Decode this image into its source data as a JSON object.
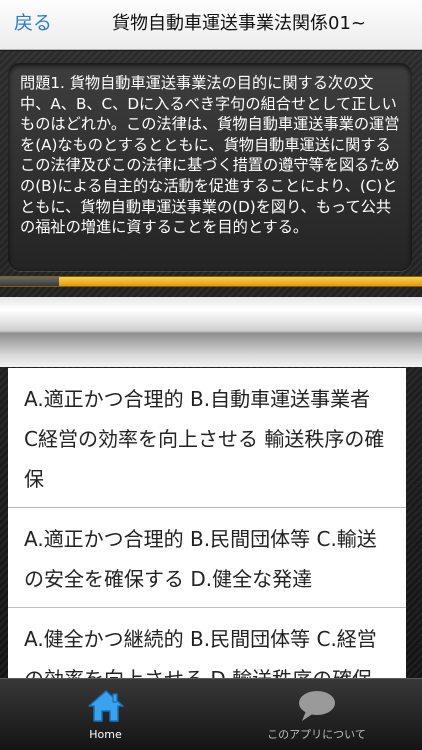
{
  "navbar": {
    "back_label": "戻る",
    "title": "貨物自動車運送事業法関係01~"
  },
  "question": {
    "text": "問題1. 貨物自動車運送事業法の目的に関する次の文中、A、B、C、Dに入るべき字句の組合せとして正しいものはどれか。この法律は、貨物自動車運送事業の運営を(A)なものとするとともに、貨物自動車運送に関するこの法律及びこの法律に基づく措置の遵守等を図るための(B)による自主的な活動を促進することにより、(C)とともに、貨物自動車運送事業の(D)を図り、もって公共の福祉の増進に資することを目的とする。"
  },
  "progress": {
    "fraction": 0.14
  },
  "answers": [
    {
      "text": "A.適正かつ合理的 B.自動車運送事業者 C経営の効率を向上させる 輸送秩序の確保"
    },
    {
      "text": "A.適正かつ合理的 B.民間団体等 C.輸送の安全を確保する D.健全な発達"
    },
    {
      "text": "A.健全かつ継続的 B.民間団体等 C.経営の効率を向上させる D.輸送秩序の確保"
    }
  ],
  "tabbar": {
    "items": [
      {
        "label": "Home",
        "icon": "home-icon",
        "selected": true
      },
      {
        "label": "このアプリについて",
        "icon": "speech-bubble-icon",
        "selected": false
      }
    ]
  },
  "colors": {
    "accent": "#2a7bd8",
    "progress_bar": "#f0b020"
  }
}
